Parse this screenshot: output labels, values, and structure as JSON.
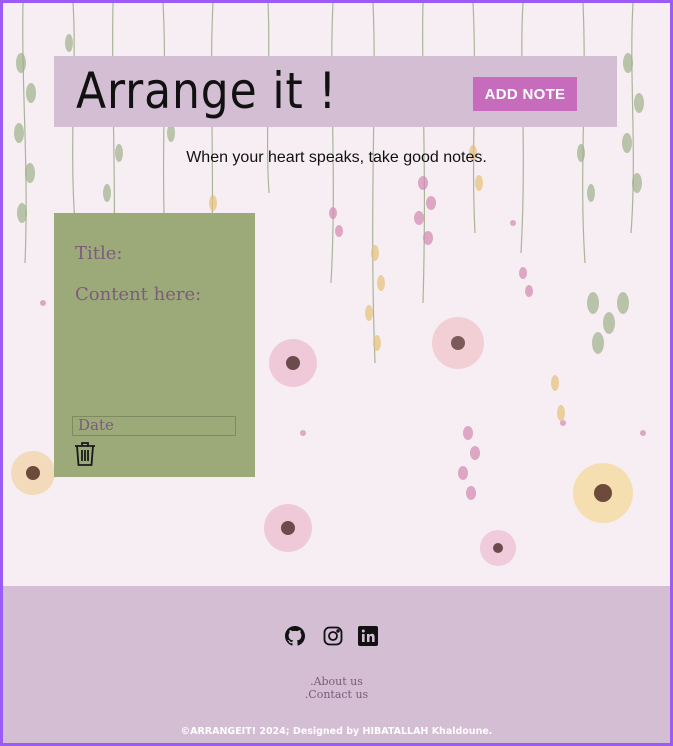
{
  "header": {
    "title": "Arrange it !",
    "add_note_label": "Add note"
  },
  "tagline": "When your heart speaks, take good notes.",
  "note": {
    "title_placeholder": "Title:",
    "content_placeholder": "Content here:",
    "date_placeholder": "Date",
    "delete_icon": "trash-icon"
  },
  "footer": {
    "social_icons": [
      "github-icon",
      "instagram-icon",
      "linkedin-icon"
    ],
    "links": [
      ".About us",
      ".Contact us"
    ],
    "copyright": "©ARRANGEIT! 2024; Designed by HIBATALLAH Khaldoune."
  },
  "colors": {
    "header_bg": "#d3bed3",
    "accent": "#c76bbd",
    "note_bg": "#9caa79",
    "note_text": "#7b5c7b",
    "border": "#9b5cf5"
  }
}
